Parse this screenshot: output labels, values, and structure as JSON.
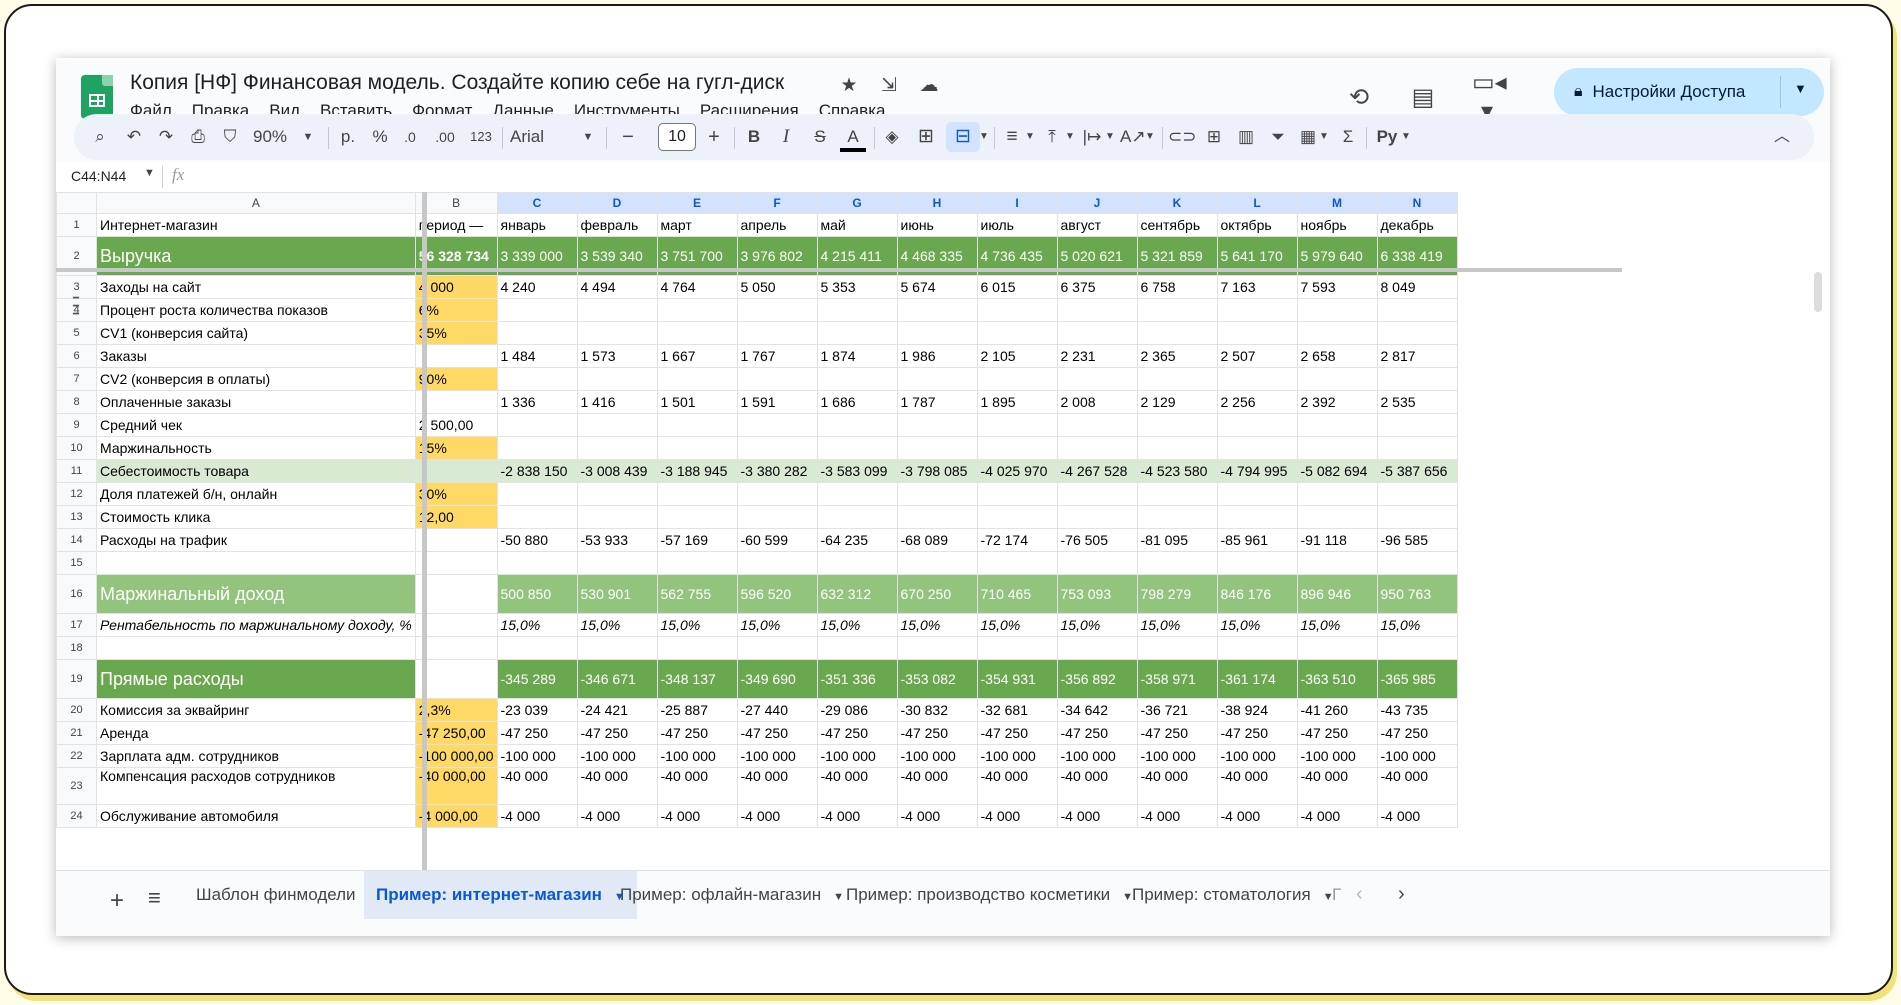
{
  "title_bar": {
    "doc_title": "Копия [НФ] Финансовая модель. Создайте копию себе на гугл-диск",
    "star_icon": "★",
    "move_icon": "⇲",
    "cloud_icon": "☁",
    "share_label": "Настройки Доступа"
  },
  "menu": [
    "Файл",
    "Правка",
    "Вид",
    "Вставить",
    "Формат",
    "Данные",
    "Инструменты",
    "Расширения",
    "Справка"
  ],
  "toolbar": {
    "zoom": "90%",
    "currency": "р.",
    "percent": "%",
    "dec_decrease": ".0",
    "dec_increase": ".00",
    "number_format": "123",
    "font": "Arial",
    "font_size": "10",
    "bold": "B",
    "italic": "I",
    "strike": "S",
    "text_color": "A",
    "input_tools": "Ру"
  },
  "formula_bar": {
    "name_box": "C44:N44",
    "fx": "fx"
  },
  "grid": {
    "col_headers": [
      "A",
      "B",
      "C",
      "D",
      "E",
      "F",
      "G",
      "H",
      "I",
      "J",
      "K",
      "L",
      "M",
      "N"
    ],
    "rows": [
      {
        "n": "1",
        "a": "Интернет-магазин",
        "b": "период —",
        "v": [
          "январь",
          "февраль",
          "март",
          "апрель",
          "май",
          "июнь",
          "июль",
          "август",
          "сентябрь",
          "октябрь",
          "ноябрь",
          "декабрь"
        ]
      },
      {
        "n": "2",
        "a": "Выручка",
        "b": "56 328 734",
        "v": [
          "3 339 000",
          "3 539 340",
          "3 751 700",
          "3 976 802",
          "4 215 411",
          "4 468 335",
          "4 736 435",
          "5 020 621",
          "5 321 859",
          "5 641 170",
          "5 979 640",
          "6 338 419"
        ]
      },
      {
        "n": "3",
        "a": "Заходы на сайт",
        "b": "4 000",
        "v": [
          "4 240",
          "4 494",
          "4 764",
          "5 050",
          "5 353",
          "5 674",
          "6 015",
          "6 375",
          "6 758",
          "7 163",
          "7 593",
          "8 049"
        ]
      },
      {
        "n": "4",
        "a": "Процент роста количества показов",
        "b": "6%",
        "v": [
          "",
          "",
          "",
          "",
          "",
          "",
          "",
          "",
          "",
          "",
          "",
          ""
        ]
      },
      {
        "n": "5",
        "a": "CV1 (конверсия сайта)",
        "b": "35%",
        "v": [
          "",
          "",
          "",
          "",
          "",
          "",
          "",
          "",
          "",
          "",
          "",
          ""
        ]
      },
      {
        "n": "6",
        "a": "Заказы",
        "b": "",
        "v": [
          "1 484",
          "1 573",
          "1 667",
          "1 767",
          "1 874",
          "1 986",
          "2 105",
          "2 231",
          "2 365",
          "2 507",
          "2 658",
          "2 817"
        ]
      },
      {
        "n": "7",
        "a": "CV2 (конверсия в оплаты)",
        "b": "90%",
        "v": [
          "",
          "",
          "",
          "",
          "",
          "",
          "",
          "",
          "",
          "",
          "",
          ""
        ]
      },
      {
        "n": "8",
        "a": "Оплаченные заказы",
        "b": "",
        "v": [
          "1 336",
          "1 416",
          "1 501",
          "1 591",
          "1 686",
          "1 787",
          "1 895",
          "2 008",
          "2 129",
          "2 256",
          "2 392",
          "2 535"
        ]
      },
      {
        "n": "9",
        "a": "Средний чек",
        "b": "2 500,00",
        "v": [
          "",
          "",
          "",
          "",
          "",
          "",
          "",
          "",
          "",
          "",
          "",
          ""
        ]
      },
      {
        "n": "10",
        "a": "Маржинальность",
        "b": "15%",
        "v": [
          "",
          "",
          "",
          "",
          "",
          "",
          "",
          "",
          "",
          "",
          "",
          ""
        ]
      },
      {
        "n": "11",
        "a": "Себестоимость товара",
        "b": "",
        "v": [
          "-2 838 150",
          "-3 008 439",
          "-3 188 945",
          "-3 380 282",
          "-3 583 099",
          "-3 798 085",
          "-4 025 970",
          "-4 267 528",
          "-4 523 580",
          "-4 794 995",
          "-5 082 694",
          "-5 387 656"
        ]
      },
      {
        "n": "12",
        "a": "Доля платежей б/н, онлайн",
        "b": "30%",
        "v": [
          "",
          "",
          "",
          "",
          "",
          "",
          "",
          "",
          "",
          "",
          "",
          ""
        ]
      },
      {
        "n": "13",
        "a": "Стоимость клика",
        "b": "12,00",
        "v": [
          "",
          "",
          "",
          "",
          "",
          "",
          "",
          "",
          "",
          "",
          "",
          ""
        ]
      },
      {
        "n": "14",
        "a": "Расходы на трафик",
        "b": "",
        "v": [
          "-50 880",
          "-53 933",
          "-57 169",
          "-60 599",
          "-64 235",
          "-68 089",
          "-72 174",
          "-76 505",
          "-81 095",
          "-85 961",
          "-91 118",
          "-96 585"
        ]
      },
      {
        "n": "15",
        "a": "",
        "b": "",
        "v": [
          "",
          "",
          "",
          "",
          "",
          "",
          "",
          "",
          "",
          "",
          "",
          ""
        ]
      },
      {
        "n": "16",
        "a": "Маржинальный доход",
        "b": "",
        "v": [
          "500 850",
          "530 901",
          "562 755",
          "596 520",
          "632 312",
          "670 250",
          "710 465",
          "753 093",
          "798 279",
          "846 176",
          "896 946",
          "950 763"
        ]
      },
      {
        "n": "17",
        "a": "Рентабельность по маржинальному доходу, %",
        "b": "",
        "v": [
          "15,0%",
          "15,0%",
          "15,0%",
          "15,0%",
          "15,0%",
          "15,0%",
          "15,0%",
          "15,0%",
          "15,0%",
          "15,0%",
          "15,0%",
          "15,0%"
        ]
      },
      {
        "n": "18",
        "a": "",
        "b": "",
        "v": [
          "",
          "",
          "",
          "",
          "",
          "",
          "",
          "",
          "",
          "",
          "",
          ""
        ]
      },
      {
        "n": "19",
        "a": "Прямые расходы",
        "b": "",
        "v": [
          "-345 289",
          "-346 671",
          "-348 137",
          "-349 690",
          "-351 336",
          "-353 082",
          "-354 931",
          "-356 892",
          "-358 971",
          "-361 174",
          "-363 510",
          "-365 985"
        ]
      },
      {
        "n": "20",
        "a": "Комиссия за эквайринг",
        "b": "2,3%",
        "v": [
          "-23 039",
          "-24 421",
          "-25 887",
          "-27 440",
          "-29 086",
          "-30 832",
          "-32 681",
          "-34 642",
          "-36 721",
          "-38 924",
          "-41 260",
          "-43 735"
        ]
      },
      {
        "n": "21",
        "a": "Аренда",
        "b": "-47 250,00",
        "v": [
          "-47 250",
          "-47 250",
          "-47 250",
          "-47 250",
          "-47 250",
          "-47 250",
          "-47 250",
          "-47 250",
          "-47 250",
          "-47 250",
          "-47 250",
          "-47 250"
        ]
      },
      {
        "n": "22",
        "a": "Зарплата адм. сотрудников",
        "b": "-100 000,00",
        "v": [
          "-100 000",
          "-100 000",
          "-100 000",
          "-100 000",
          "-100 000",
          "-100 000",
          "-100 000",
          "-100 000",
          "-100 000",
          "-100 000",
          "-100 000",
          "-100 000"
        ]
      },
      {
        "n": "23",
        "a": "Компенсация расходов сотрудников",
        "b": "-40 000,00",
        "v": [
          "-40 000",
          "-40 000",
          "-40 000",
          "-40 000",
          "-40 000",
          "-40 000",
          "-40 000",
          "-40 000",
          "-40 000",
          "-40 000",
          "-40 000",
          "-40 000"
        ]
      },
      {
        "n": "24",
        "a": "Обслуживание автомобиля",
        "b": "-4 000,00",
        "v": [
          "-4 000",
          "-4 000",
          "-4 000",
          "-4 000",
          "-4 000",
          "-4 000",
          "-4 000",
          "-4 000",
          "-4 000",
          "-4 000",
          "-4 000",
          "-4 000"
        ]
      }
    ]
  },
  "sheet_tabs": {
    "items": [
      {
        "label": "Шаблон финмодели",
        "active": false
      },
      {
        "label": "Пример: интернет-магазин",
        "active": true
      },
      {
        "label": "Пример: офлайн-магазин",
        "active": false
      },
      {
        "label": "Пример: производство косметики",
        "active": false
      },
      {
        "label": "Пример: стоматология",
        "active": false
      }
    ],
    "overflow": "Г"
  },
  "colors": {
    "revenue_green": "#6aa84f",
    "light_green": "#93c47d",
    "pale_green": "#d9ead3",
    "input_yellow": "#ffd966",
    "share_blue": "#c2e7ff"
  }
}
